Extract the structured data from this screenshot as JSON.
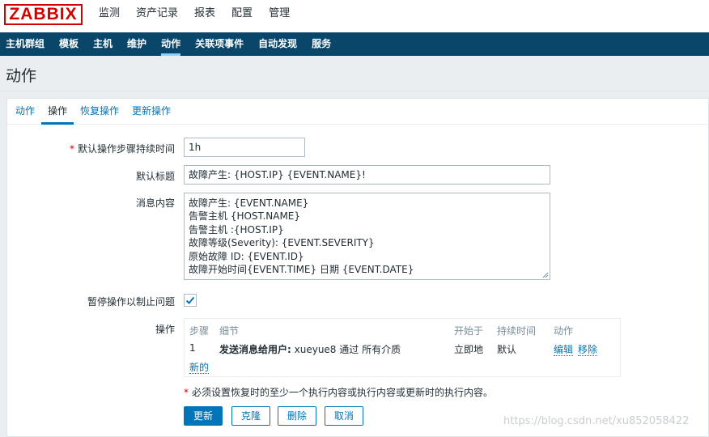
{
  "app": {
    "logo_text": "ZABBIX",
    "brand_color": "#d40000"
  },
  "main_menu": [
    {
      "label": "监测"
    },
    {
      "label": "资产记录"
    },
    {
      "label": "报表"
    },
    {
      "label": "配置"
    },
    {
      "label": "管理"
    }
  ],
  "sub_menu": [
    {
      "label": "主机群组"
    },
    {
      "label": "模板"
    },
    {
      "label": "主机"
    },
    {
      "label": "维护"
    },
    {
      "label": "动作",
      "active": true
    },
    {
      "label": "关联项事件"
    },
    {
      "label": "自动发现"
    },
    {
      "label": "服务"
    }
  ],
  "page_title": "动作",
  "tabs": [
    {
      "label": "动作"
    },
    {
      "label": "操作",
      "active": true
    },
    {
      "label": "恢复操作"
    },
    {
      "label": "更新操作"
    }
  ],
  "form": {
    "step_duration": {
      "label": "默认操作步骤持续时间",
      "required_mark": "*",
      "value": "1h"
    },
    "default_subject": {
      "label": "默认标题",
      "value": "故障产生: {HOST.IP} {EVENT.NAME}!"
    },
    "message": {
      "label": "消息内容",
      "lines": [
        "故障产生: {EVENT.NAME}",
        "告警主机 {HOST.NAME}",
        "告警主机 :{HOST.IP}",
        "故障等级(Severity): {EVENT.SEVERITY}",
        "原始故障 ID: {EVENT.ID}",
        "故障开始时间{EVENT.TIME} 日期 {EVENT.DATE}"
      ]
    },
    "pause_on_suppress": {
      "label": "暂停操作以制止问题",
      "checked": true
    },
    "operations": {
      "label": "操作",
      "columns": {
        "step": "步骤",
        "details": "细节",
        "start_in": "开始于",
        "duration": "持续时间",
        "action": "动作"
      },
      "rows": [
        {
          "step": "1",
          "details_bold": "发送消息给用户:",
          "details_rest": " xueyue8 通过 所有介质",
          "start_in": "立即地",
          "duration": "默认",
          "edit": "编辑",
          "remove": "移除"
        }
      ],
      "new_link": "新的"
    },
    "note": {
      "mark": "*",
      "text": "必须设置恢复时的至少一个执行内容或执行内容或更新时的执行内容。"
    }
  },
  "buttons": {
    "update": "更新",
    "clone": "克隆",
    "delete": "删除",
    "cancel": "取消"
  },
  "watermark": "https://blog.csdn.net/xu852058422"
}
